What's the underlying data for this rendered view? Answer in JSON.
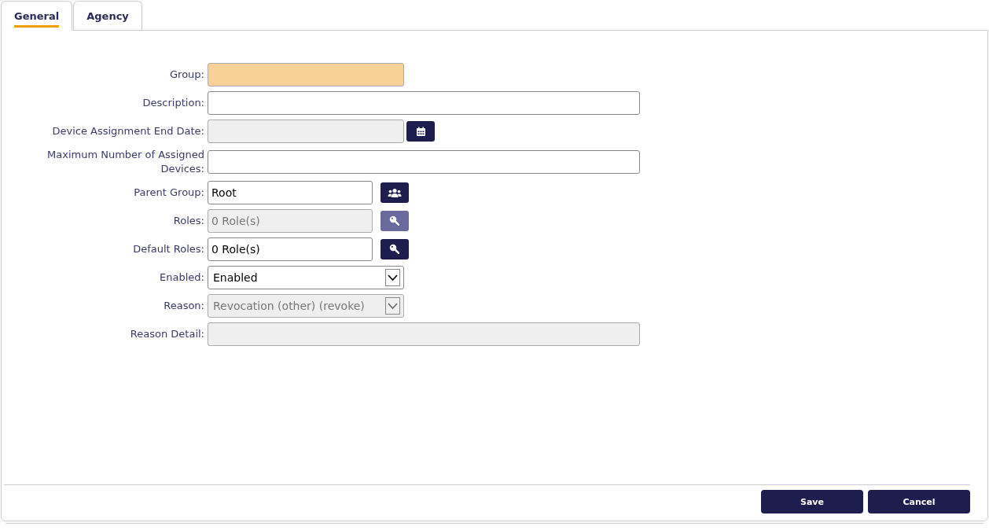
{
  "tabs": [
    {
      "label": "General",
      "selected": true
    },
    {
      "label": "Agency",
      "selected": false
    }
  ],
  "fields": [
    {
      "label": "Group:",
      "kind": "text",
      "required": true,
      "disabled": false
    },
    {
      "label": "Description:",
      "kind": "text",
      "required": false,
      "disabled": false
    },
    {
      "label": "Device Assignment End Date:",
      "kind": "date",
      "required": false,
      "disabled": true
    },
    {
      "label": "Maximum Number of Assigned Devices:",
      "kind": "text",
      "required": false,
      "disabled": false
    },
    {
      "label": "Parent Group:",
      "kind": "lookup",
      "button": {
        "kind": "group",
        "disabled": false
      },
      "value": "Root",
      "required": false,
      "disabled": false
    },
    {
      "label": "Roles:",
      "kind": "lookup",
      "button": {
        "kind": "roles",
        "disabled": true
      },
      "value": "0 Role(s)",
      "required": false,
      "disabled": true
    },
    {
      "label": "Default Roles:",
      "kind": "lookup",
      "button": {
        "kind": "roles",
        "disabled": false
      },
      "value": "0 Role(s)",
      "required": false,
      "disabled": false
    },
    {
      "label": "Enabled:",
      "kind": "select",
      "value": "Enabled",
      "required": false,
      "disabled": false
    },
    {
      "label": "Reason:",
      "kind": "select",
      "value": "Revocation (other) (revoke)",
      "required": false,
      "disabled": true
    },
    {
      "label": "Reason Detail:",
      "kind": "text",
      "required": false,
      "disabled": true
    }
  ],
  "buttons": [
    "Save",
    "Cancel"
  ]
}
